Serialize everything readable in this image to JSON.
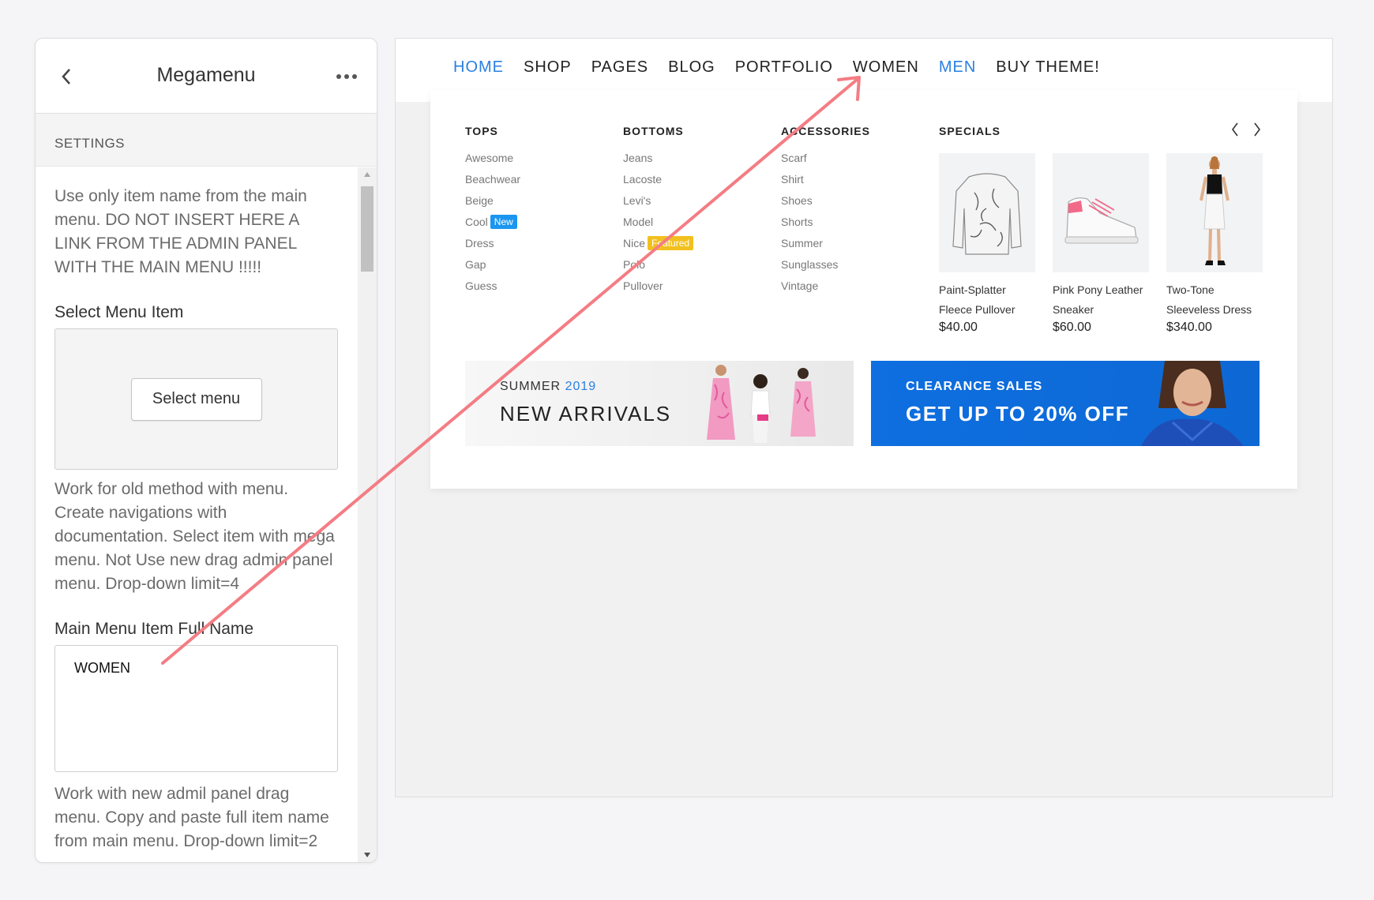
{
  "panel": {
    "title": "Megamenu",
    "section": "SETTINGS",
    "help_top": "Use only item name from the main menu. DO NOT INSERT HERE A LINK FROM THE ADMIN PANEL WITH THE MAIN MENU !!!!!",
    "select_label": "Select Menu Item",
    "select_button": "Select menu",
    "help_mid": "Work for old method with menu. Create navigations with documentation. Select item with mega menu. Not Use new drag admin panel menu. Drop-down limit=4",
    "fullname_label": "Main Menu Item Full Name",
    "fullname_value": "WOMEN",
    "help_bot": "Work with new admil panel drag menu. Copy and paste full item name from main menu. Drop-down limit=2"
  },
  "nav": {
    "items": [
      "HOME",
      "SHOP",
      "PAGES",
      "BLOG",
      "PORTFOLIO",
      "WOMEN",
      "MEN",
      "BUY THEME!"
    ],
    "active_color": "#2a7fe0"
  },
  "megamenu": {
    "columns": [
      {
        "title": "TOPS",
        "items": [
          "Awesome",
          "Beachwear",
          "Beige",
          "Cool",
          "Dress",
          "Gap",
          "Guess"
        ]
      },
      {
        "title": "BOTTOMS",
        "items": [
          "Jeans",
          "Lacoste",
          "Levi's",
          "Model",
          "Nice",
          "Polo",
          "Pullover"
        ]
      },
      {
        "title": "ACCESSORIES",
        "items": [
          "Scarf",
          "Shirt",
          "Shoes",
          "Shorts",
          "Summer",
          "Sunglasses",
          "Vintage"
        ]
      }
    ],
    "badges": {
      "new": "New",
      "featured": "Featured"
    },
    "specials": {
      "title": "SPECIALS",
      "products": [
        {
          "name": "Paint-Splatter Fleece Pullover",
          "price": "$40.00"
        },
        {
          "name": "Pink Pony Leather Sneaker",
          "price": "$60.00"
        },
        {
          "name": "Two-Tone Sleeveless Dress",
          "price": "$340.00"
        }
      ]
    },
    "banners": {
      "left": {
        "sub": "SUMMER",
        "year": "2019",
        "main": "NEW ARRIVALS"
      },
      "right": {
        "sub": "CLEARANCE SALES",
        "main": "GET UP TO 20% OFF"
      }
    }
  },
  "colors": {
    "accent": "#2a7fe0",
    "arrow": "#f47c84",
    "banner_blue": "#0f6fe0"
  }
}
